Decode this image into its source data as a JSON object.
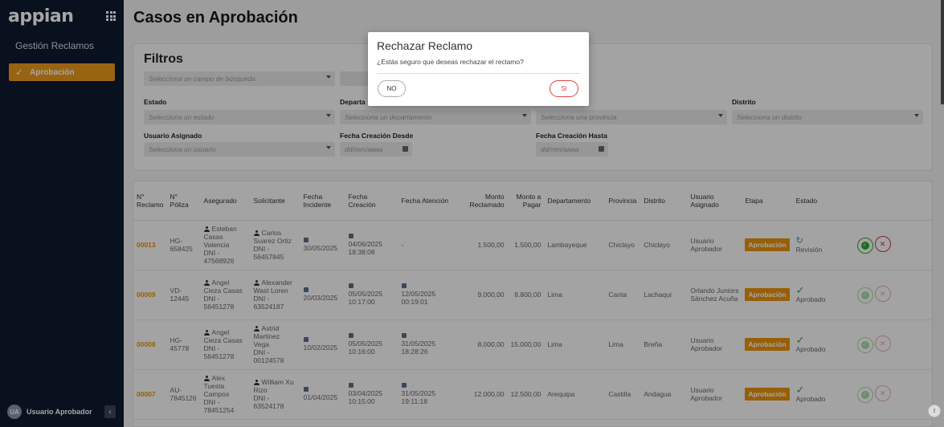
{
  "app": {
    "logo": "appian",
    "nav_title": "Gestión Reclamos",
    "nav_item": "Aprobación"
  },
  "user": {
    "initials": "UA",
    "name": "Usuario Aprobador"
  },
  "page": {
    "title": "Casos en Aprobación"
  },
  "filters": {
    "title": "Filtros",
    "search_placeholder": "Selecciona un campo de búsqueda",
    "estado_label": "Estado",
    "estado_placeholder": "Selecciona un estado",
    "departamento_label": "Departa",
    "departamento_placeholder": "Selecciona un departamento",
    "provincia_placeholder": "Selecciona una provincia",
    "distrito_label": "Distrito",
    "distrito_placeholder": "Selecciona un distrito",
    "usuario_label": "Usuario Asignado",
    "usuario_placeholder": "Selecciona un usuario",
    "desde_label": "Fecha Creación Desde",
    "hasta_label": "Fecha Creación Hasta",
    "date_placeholder": "dd/mm/aaaa"
  },
  "table": {
    "headers": [
      "N° Reclamo",
      "N° Póliza",
      "Asegurado",
      "Solicitante",
      "Fecha Incidente",
      "Fecha Creación",
      "Fecha Atención",
      "Monto Reclamado",
      "Monto a Pagar",
      "Departamento",
      "Provincia",
      "Distrito",
      "Usuario Asignado",
      "Etapa",
      "Estado"
    ],
    "rows": [
      {
        "reclamo": "00013",
        "poliza": "HG-658425",
        "asegurado": "Esteban Casas Valencia",
        "asegurado_dni": "DNI - 47568926",
        "solicitante": "Carlos Suarez Ortiz",
        "solicitante_dni": "DNI - 56457845",
        "f_incidente": "30/05/2025",
        "f_creacion": "04/06/2025 18:38:08",
        "f_atencion": "-",
        "monto_reclamado": "1.500,00",
        "monto_pagar": "1.500,00",
        "departamento": "Lambayeque",
        "provincia": "Chiclayo",
        "distrito": "Chiclayo",
        "usuario": "Usuario Aprobador",
        "etapa": "Aprobación",
        "estado": "Revisión"
      },
      {
        "reclamo": "00009",
        "poliza": "VD-12445",
        "asegurado": "Angel Cieza Casas",
        "asegurado_dni": "DNI - 56451278",
        "solicitante": "Alexander Wast Loren",
        "solicitante_dni": "DNI - 63524187",
        "f_incidente": "20/03/2025",
        "f_creacion": "05/05/2025 10:17:00",
        "f_atencion": "12/05/2025 00:19:01",
        "monto_reclamado": "9.000,00",
        "monto_pagar": "8.800,00",
        "departamento": "Lima",
        "provincia": "Canta",
        "distrito": "Lachaqui",
        "usuario": "Orlando Juniors Sánchez Acuña",
        "etapa": "Aprobación",
        "estado": "Aprobado"
      },
      {
        "reclamo": "00008",
        "poliza": "HG-45778",
        "asegurado": "Angel Cieza Casas",
        "asegurado_dni": "DNI - 56451278",
        "solicitante": "Astrid Martinez Vega",
        "solicitante_dni": "DNI - 00124578",
        "f_incidente": "10/02/2025",
        "f_creacion": "05/05/2025 10:16:00",
        "f_atencion": "31/05/2025 18:28:26",
        "monto_reclamado": "8.000,00",
        "monto_pagar": "15.000,00",
        "departamento": "Lima",
        "provincia": "Lima",
        "distrito": "Breña",
        "usuario": "Usuario Aprobador",
        "etapa": "Aprobación",
        "estado": "Aprobado"
      },
      {
        "reclamo": "00007",
        "poliza": "AU-7845126",
        "asegurado": "Alex Tuesta Campos",
        "asegurado_dni": "DNI - 78451254",
        "solicitante": "William Xu Rizo",
        "solicitante_dni": "DNI - 63524178",
        "f_incidente": "01/04/2025",
        "f_creacion": "03/04/2025 10:15:00",
        "f_atencion": "31/05/2025 19:11:18",
        "monto_reclamado": "12.000,00",
        "monto_pagar": "12.500,00",
        "departamento": "Arequipa",
        "provincia": "Castilla",
        "distrito": "Andagua",
        "usuario": "Usuario Aprobador",
        "etapa": "Aprobación",
        "estado": "Aprobado"
      }
    ]
  },
  "modal": {
    "title": "Rechazar Reclamo",
    "message": "¿Estás seguro que deseas rechazar el reclamo?",
    "no_label": "NO",
    "si_label": "SI"
  },
  "icons": {
    "approve": "check-circle-icon",
    "reject": "x-circle-icon"
  },
  "colors": {
    "accent": "#e8930c",
    "sidebar": "#0f1a2e",
    "reject": "#c8334a",
    "approve": "#2aa830"
  }
}
